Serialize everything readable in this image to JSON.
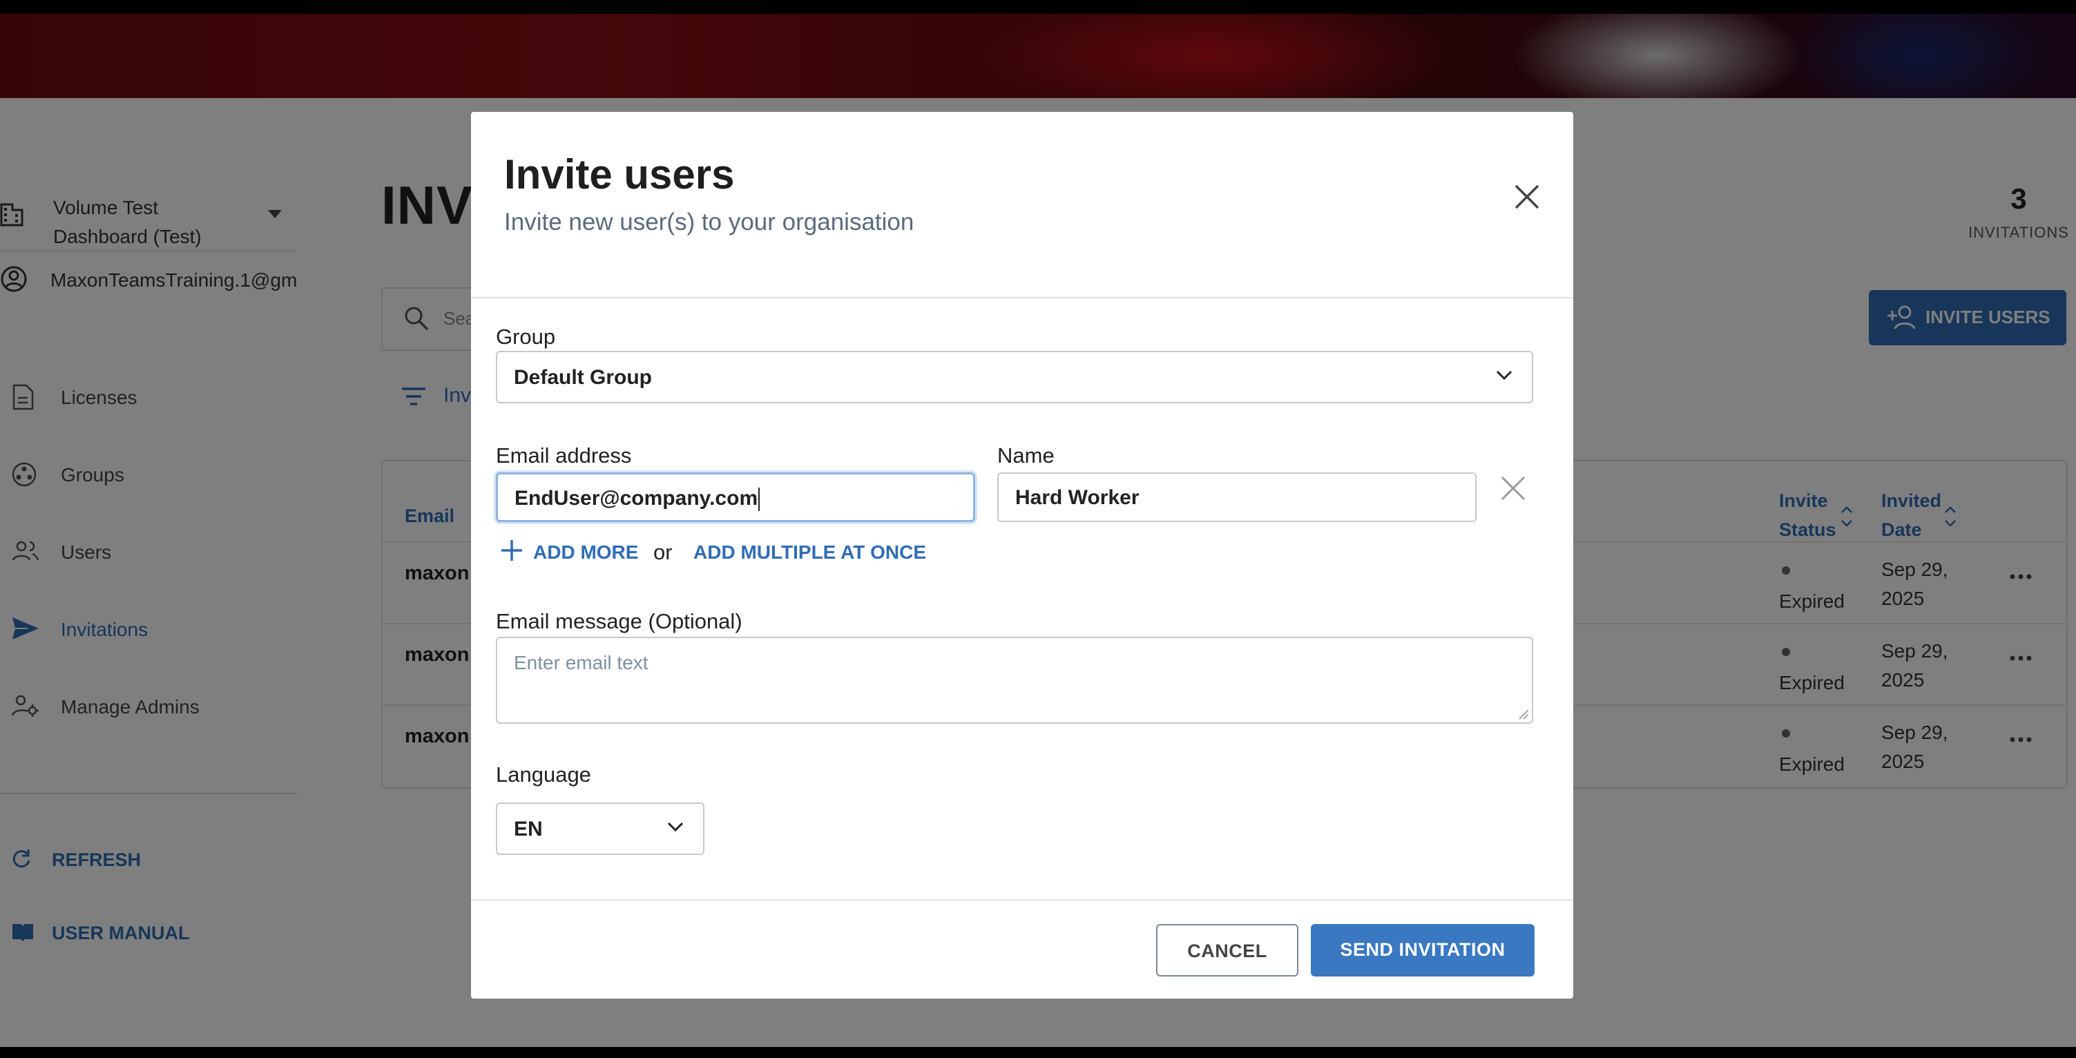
{
  "sidebar": {
    "org_name": "Volume Test Dashboard (Test)",
    "account": "MaxonTeamsTraining.1@gm",
    "nav": [
      {
        "label": "Licenses",
        "icon": "document-icon"
      },
      {
        "label": "Groups",
        "icon": "groups-icon"
      },
      {
        "label": "Users",
        "icon": "users-icon"
      },
      {
        "label": "Invitations",
        "icon": "send-icon"
      },
      {
        "label": "Manage Admins",
        "icon": "admin-gear-icon"
      }
    ],
    "active_nav": "Invitations",
    "refresh_label": "REFRESH",
    "manual_label": "USER MANUAL"
  },
  "main": {
    "title_visible": "INVI",
    "search_placeholder_visible": "Sea",
    "filter_label_visible": "Inv",
    "count": {
      "value": "3",
      "caption": "INVITATIONS"
    },
    "invite_button": "INVITE USERS",
    "table": {
      "headers": {
        "email": "Email",
        "status": "Invite Status",
        "date": "Invited Date"
      },
      "rows": [
        {
          "email": "maxon",
          "status": "Expired",
          "date": "Sep 29, 2025"
        },
        {
          "email": "maxon",
          "status": "Expired",
          "date": "Sep 29, 2025"
        },
        {
          "email": "maxon",
          "status": "Expired",
          "date": "Sep 29, 2025"
        }
      ]
    }
  },
  "modal": {
    "title": "Invite users",
    "subtitle": "Invite new user(s) to your organisation",
    "group_label": "Group",
    "group_value": "Default Group",
    "email_label": "Email address",
    "email_value": "EndUser@company.com",
    "name_label": "Name",
    "name_value": "Hard Worker",
    "add_more": "ADD MORE",
    "or_text": "or",
    "add_multiple": "ADD MULTIPLE AT ONCE",
    "message_label": "Email message (Optional)",
    "message_placeholder": "Enter email text",
    "language_label": "Language",
    "language_value": "EN",
    "cancel": "CANCEL",
    "send": "SEND INVITATION"
  },
  "colors": {
    "accent": "#2f6db5",
    "primary_button": "#3a78c2",
    "overlay": "rgba(0,0,0,0.5)"
  }
}
